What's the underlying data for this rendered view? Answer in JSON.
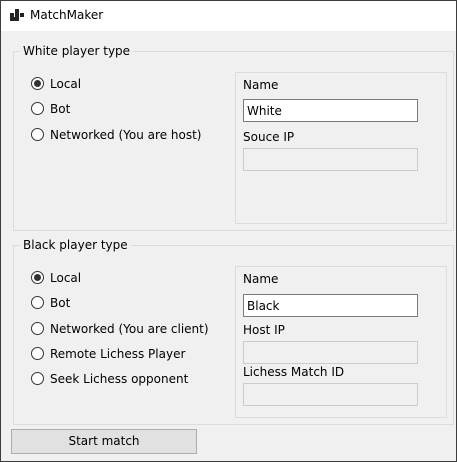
{
  "window": {
    "title": "MatchMaker",
    "icon": "board-pieces-icon"
  },
  "white_group": {
    "legend": "White player type",
    "options": [
      {
        "label": "Local",
        "selected": true
      },
      {
        "label": "Bot",
        "selected": false
      },
      {
        "label": "Networked (You are host)",
        "selected": false
      }
    ],
    "name_label": "Name",
    "name_value": "White",
    "ip_label": "Souce IP",
    "ip_value": ""
  },
  "black_group": {
    "legend": "Black player type",
    "options": [
      {
        "label": "Local",
        "selected": true
      },
      {
        "label": "Bot",
        "selected": false
      },
      {
        "label": "Networked (You are client)",
        "selected": false
      },
      {
        "label": "Remote Lichess Player",
        "selected": false
      },
      {
        "label": "Seek Lichess opponent",
        "selected": false
      }
    ],
    "name_label": "Name",
    "name_value": "Black",
    "host_ip_label": "Host IP",
    "host_ip_value": "",
    "lichess_label": "Lichess Match ID",
    "lichess_value": ""
  },
  "start_button": {
    "label": "Start match"
  }
}
